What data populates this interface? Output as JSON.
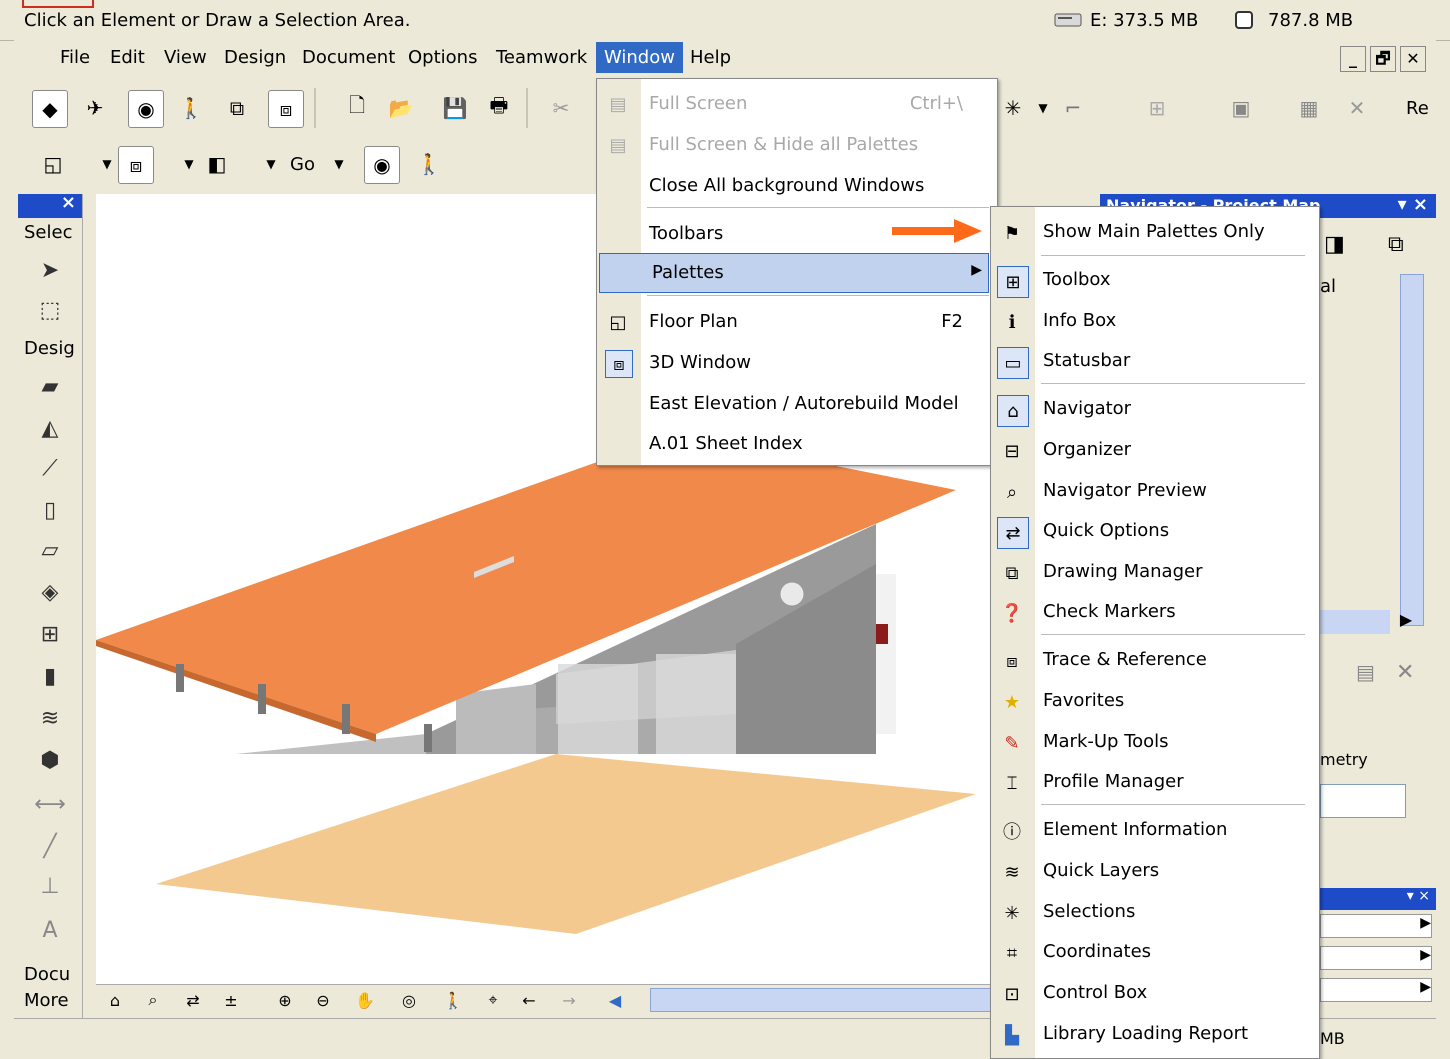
{
  "status": {
    "message": "Click an Element or Draw a Selection Area.",
    "memory_e": "E: 373.5 MB",
    "memory_total": "787.8 MB",
    "bottom_mem": "MB"
  },
  "menubar": {
    "items": [
      "File",
      "Edit",
      "View",
      "Design",
      "Document",
      "Options",
      "Teamwork",
      "Window",
      "Help"
    ],
    "active": "Window"
  },
  "window_controls": [
    "_",
    "🗗",
    "✕"
  ],
  "toolbar": {
    "go_label": "Go",
    "re_label": "Re"
  },
  "left_palette": {
    "select_label": "Selec",
    "design_label": "Desig",
    "document_label": "Docu",
    "more_label": "More"
  },
  "right_panel": {
    "title": "Navigator - Project Map",
    "partial_a": "al",
    "partial_b": "metry"
  },
  "window_menu": {
    "items": [
      {
        "label": "Full Screen",
        "shortcut": "Ctrl+\\",
        "disabled": true,
        "icon": "fullscreen-icon"
      },
      {
        "label": "Full Screen & Hide all Palettes",
        "shortcut": "",
        "disabled": true,
        "icon": "fullscreen-hide-icon"
      },
      {
        "label": "Close All background Windows",
        "shortcut": "",
        "disabled": false,
        "icon": ""
      },
      {
        "label": "Toolbars",
        "shortcut": "",
        "disabled": false,
        "icon": ""
      },
      {
        "label": "Palettes",
        "shortcut": "",
        "disabled": false,
        "icon": "",
        "highlighted": true
      },
      {
        "label": "Floor Plan",
        "shortcut": "F2",
        "disabled": false,
        "icon": "floor-plan-icon"
      },
      {
        "label": "3D Window",
        "shortcut": "",
        "disabled": false,
        "icon": "3d-window-icon"
      },
      {
        "label": "East Elevation / Autorebuild Model",
        "shortcut": "",
        "disabled": false,
        "icon": ""
      },
      {
        "label": "A.01 Sheet Index",
        "shortcut": "",
        "disabled": false,
        "icon": ""
      }
    ]
  },
  "palettes_submenu": {
    "items": [
      {
        "label": "Show Main Palettes Only",
        "icon": "flag-icon"
      },
      {
        "label": "Toolbox",
        "icon": "toolbox-icon"
      },
      {
        "label": "Info Box",
        "icon": "info-box-icon"
      },
      {
        "label": "Statusbar",
        "icon": "statusbar-icon"
      },
      {
        "label": "Navigator",
        "icon": "navigator-icon"
      },
      {
        "label": "Organizer",
        "icon": "organizer-icon"
      },
      {
        "label": "Navigator Preview",
        "icon": "navigator-preview-icon"
      },
      {
        "label": "Quick Options",
        "icon": "quick-options-icon"
      },
      {
        "label": "Drawing Manager",
        "icon": "drawing-manager-icon"
      },
      {
        "label": "Check Markers",
        "icon": "check-markers-icon"
      },
      {
        "label": "Trace & Reference",
        "icon": "trace-reference-icon"
      },
      {
        "label": "Favorites",
        "icon": "favorites-icon"
      },
      {
        "label": "Mark-Up Tools",
        "icon": "markup-tools-icon"
      },
      {
        "label": "Profile Manager",
        "icon": "profile-manager-icon"
      },
      {
        "label": "Element Information",
        "icon": "element-information-icon"
      },
      {
        "label": "Quick Layers",
        "icon": "quick-layers-icon"
      },
      {
        "label": "Selections",
        "icon": "selections-icon"
      },
      {
        "label": "Coordinates",
        "icon": "coordinates-icon"
      },
      {
        "label": "Control Box",
        "icon": "control-box-icon"
      },
      {
        "label": "Library Loading Report",
        "icon": "library-loading-report-icon"
      }
    ]
  },
  "colors": {
    "accent": "#316ac5",
    "highlight": "#c1d2ee",
    "roof": "#f0894a",
    "arrow": "#ff6a1a"
  }
}
